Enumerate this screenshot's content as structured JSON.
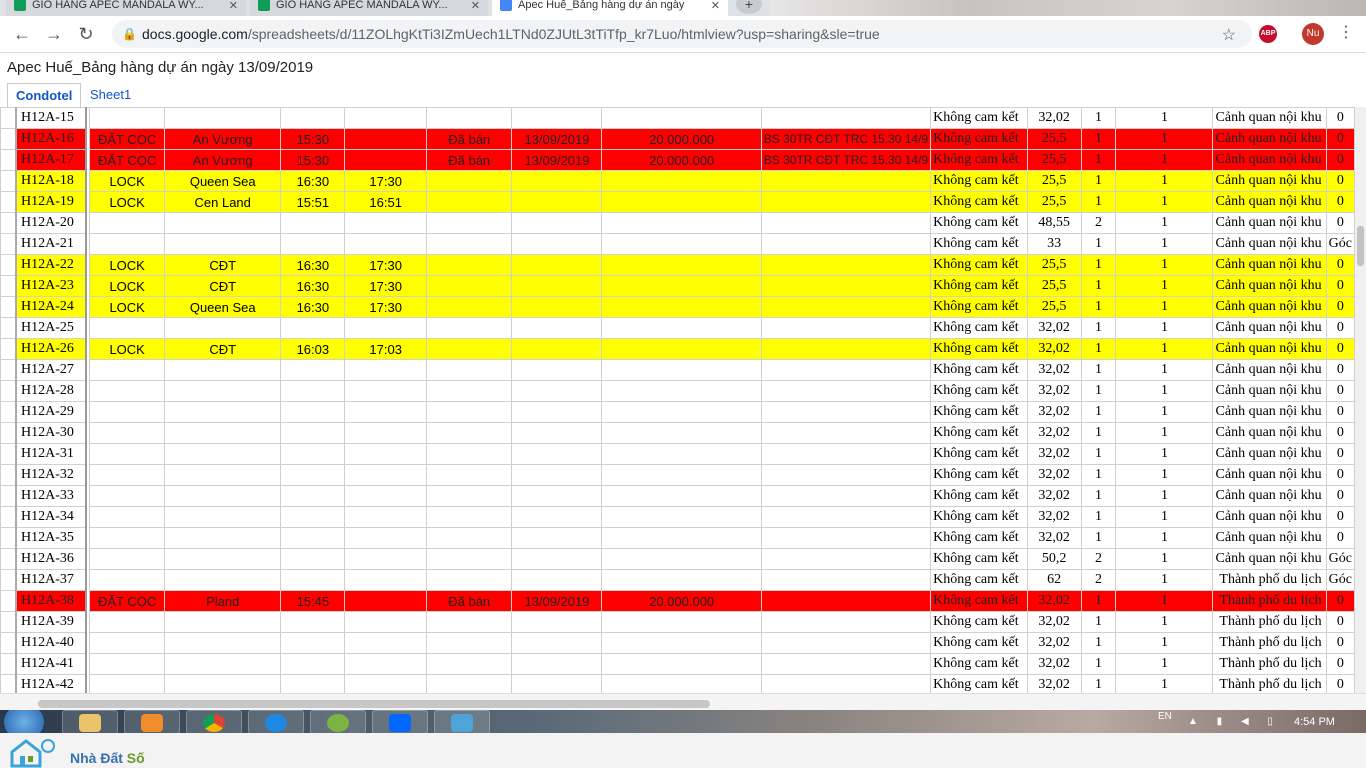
{
  "tabs": [
    {
      "title": "GIO HANG APEC MANDALA WY...",
      "icon_color": "#0f9d58"
    },
    {
      "title": "GIO HANG APEC MANDALA WY...",
      "icon_color": "#0f9d58"
    },
    {
      "title": "Apec Huế_Bảng hàng dự án ngày",
      "icon_color": "#4285f4"
    }
  ],
  "browser": {
    "url_host": "docs.google.com",
    "url_path": "/spreadsheets/d/11ZOLhgKtTi3IZmUech1LTNd0ZJUtL3tTiTfp_kr7Luo/htmlview?usp=sharing&sle=true",
    "abp_label": "ABP",
    "avatar_label": "Nu"
  },
  "doc": {
    "title": "Apec Huế_Bảng hàng dự án ngày 13/09/2019",
    "sheet_tabs": [
      "Condotel",
      "Sheet1"
    ],
    "active_sheet": "Condotel"
  },
  "colors": {
    "red": "#ff0000",
    "yellow": "#ffff00"
  },
  "rows": [
    {
      "rn": "",
      "code": "H12A-15",
      "status": "",
      "agent": "",
      "t1": "",
      "t2": "",
      "sold": "",
      "date": "",
      "deposit": "",
      "note": "",
      "commit": "Không cam kết",
      "area": "32,02",
      "br": "1",
      "wc": "1",
      "view": "Cảnh quan nội khu",
      "extra": "0",
      "style": "none"
    },
    {
      "rn": "",
      "code": "H12A-16",
      "status": "ĐẶT CỌC",
      "agent": "An Vương",
      "t1": "15:30",
      "t2": "",
      "sold": "Đã bán",
      "date": "13/09/2019",
      "deposit": "20.000.000",
      "note": "BS 30TR CĐT TRC 15.30 14/9",
      "commit": "Không cam kết",
      "area": "25,5",
      "br": "1",
      "wc": "1",
      "view": "Cảnh quan nội khu",
      "extra": "0",
      "style": "red"
    },
    {
      "rn": "",
      "code": "H12A-17",
      "status": "ĐẶT CỌC",
      "agent": "An Vương",
      "t1": "15:30",
      "t2": "",
      "sold": "Đã bán",
      "date": "13/09/2019",
      "deposit": "20.000.000",
      "note": "BS 30TR CĐT TRC 15.30 14/9",
      "commit": "Không cam kết",
      "area": "25,5",
      "br": "1",
      "wc": "1",
      "view": "Cảnh quan nội khu",
      "extra": "0",
      "style": "red"
    },
    {
      "rn": "",
      "code": "H12A-18",
      "status": "LOCK",
      "agent": "Queen Sea",
      "t1": "16:30",
      "t2": "17:30",
      "sold": "",
      "date": "",
      "deposit": "",
      "note": "",
      "commit": "Không cam kết",
      "area": "25,5",
      "br": "1",
      "wc": "1",
      "view": "Cảnh quan nội khu",
      "extra": "0",
      "style": "yellow"
    },
    {
      "rn": "",
      "code": "H12A-19",
      "status": "LOCK",
      "agent": "Cen Land",
      "t1": "15:51",
      "t2": "16:51",
      "sold": "",
      "date": "",
      "deposit": "",
      "note": "",
      "commit": "Không cam kết",
      "area": "25,5",
      "br": "1",
      "wc": "1",
      "view": "Cảnh quan nội khu",
      "extra": "0",
      "style": "yellow"
    },
    {
      "rn": "",
      "code": "H12A-20",
      "status": "",
      "agent": "",
      "t1": "",
      "t2": "",
      "sold": "",
      "date": "",
      "deposit": "",
      "note": "",
      "commit": "Không cam kết",
      "area": "48,55",
      "br": "2",
      "wc": "1",
      "view": "Cảnh quan nội khu",
      "extra": "0",
      "style": "none"
    },
    {
      "rn": "",
      "code": "H12A-21",
      "status": "",
      "agent": "",
      "t1": "",
      "t2": "",
      "sold": "",
      "date": "",
      "deposit": "",
      "note": "",
      "commit": "Không cam kết",
      "area": "33",
      "br": "1",
      "wc": "1",
      "view": "Cảnh quan nội khu",
      "extra": "Góc",
      "style": "none"
    },
    {
      "rn": "",
      "code": "H12A-22",
      "status": "LOCK",
      "agent": "CĐT",
      "t1": "16:30",
      "t2": "17:30",
      "sold": "",
      "date": "",
      "deposit": "",
      "note": "",
      "commit": "Không cam kết",
      "area": "25,5",
      "br": "1",
      "wc": "1",
      "view": "Cảnh quan nội khu",
      "extra": "0",
      "style": "yellow"
    },
    {
      "rn": "",
      "code": "H12A-23",
      "status": "LOCK",
      "agent": "CĐT",
      "t1": "16:30",
      "t2": "17:30",
      "sold": "",
      "date": "",
      "deposit": "",
      "note": "",
      "commit": "Không cam kết",
      "area": "25,5",
      "br": "1",
      "wc": "1",
      "view": "Cảnh quan nội khu",
      "extra": "0",
      "style": "yellow"
    },
    {
      "rn": "",
      "code": "H12A-24",
      "status": "LOCK",
      "agent": "Queen Sea",
      "t1": "16:30",
      "t2": "17:30",
      "sold": "",
      "date": "",
      "deposit": "",
      "note": "",
      "commit": "Không cam kết",
      "area": "25,5",
      "br": "1",
      "wc": "1",
      "view": "Cảnh quan nội khu",
      "extra": "0",
      "style": "yellow"
    },
    {
      "rn": "",
      "code": "H12A-25",
      "status": "",
      "agent": "",
      "t1": "",
      "t2": "",
      "sold": "",
      "date": "",
      "deposit": "",
      "note": "",
      "commit": "Không cam kết",
      "area": "32,02",
      "br": "1",
      "wc": "1",
      "view": "Cảnh quan nội khu",
      "extra": "0",
      "style": "none"
    },
    {
      "rn": "",
      "code": "H12A-26",
      "status": "LOCK",
      "agent": "CĐT",
      "t1": "16:03",
      "t2": "17:03",
      "sold": "",
      "date": "",
      "deposit": "",
      "note": "",
      "commit": "Không cam kết",
      "area": "32,02",
      "br": "1",
      "wc": "1",
      "view": "Cảnh quan nội khu",
      "extra": "0",
      "style": "yellow"
    },
    {
      "rn": "",
      "code": "H12A-27",
      "status": "",
      "agent": "",
      "t1": "",
      "t2": "",
      "sold": "",
      "date": "",
      "deposit": "",
      "note": "",
      "commit": "Không cam kết",
      "area": "32,02",
      "br": "1",
      "wc": "1",
      "view": "Cảnh quan nội khu",
      "extra": "0",
      "style": "none"
    },
    {
      "rn": "",
      "code": "H12A-28",
      "status": "",
      "agent": "",
      "t1": "",
      "t2": "",
      "sold": "",
      "date": "",
      "deposit": "",
      "note": "",
      "commit": "Không cam kết",
      "area": "32,02",
      "br": "1",
      "wc": "1",
      "view": "Cảnh quan nội khu",
      "extra": "0",
      "style": "none"
    },
    {
      "rn": "",
      "code": "H12A-29",
      "status": "",
      "agent": "",
      "t1": "",
      "t2": "",
      "sold": "",
      "date": "",
      "deposit": "",
      "note": "",
      "commit": "Không cam kết",
      "area": "32,02",
      "br": "1",
      "wc": "1",
      "view": "Cảnh quan nội khu",
      "extra": "0",
      "style": "none"
    },
    {
      "rn": "",
      "code": "H12A-30",
      "status": "",
      "agent": "",
      "t1": "",
      "t2": "",
      "sold": "",
      "date": "",
      "deposit": "",
      "note": "",
      "commit": "Không cam kết",
      "area": "32,02",
      "br": "1",
      "wc": "1",
      "view": "Cảnh quan nội khu",
      "extra": "0",
      "style": "none"
    },
    {
      "rn": "",
      "code": "H12A-31",
      "status": "",
      "agent": "",
      "t1": "",
      "t2": "",
      "sold": "",
      "date": "",
      "deposit": "",
      "note": "",
      "commit": "Không cam kết",
      "area": "32,02",
      "br": "1",
      "wc": "1",
      "view": "Cảnh quan nội khu",
      "extra": "0",
      "style": "none"
    },
    {
      "rn": "",
      "code": "H12A-32",
      "status": "",
      "agent": "",
      "t1": "",
      "t2": "",
      "sold": "",
      "date": "",
      "deposit": "",
      "note": "",
      "commit": "Không cam kết",
      "area": "32,02",
      "br": "1",
      "wc": "1",
      "view": "Cảnh quan nội khu",
      "extra": "0",
      "style": "none"
    },
    {
      "rn": "",
      "code": "H12A-33",
      "status": "",
      "agent": "",
      "t1": "",
      "t2": "",
      "sold": "",
      "date": "",
      "deposit": "",
      "note": "",
      "commit": "Không cam kết",
      "area": "32,02",
      "br": "1",
      "wc": "1",
      "view": "Cảnh quan nội khu",
      "extra": "0",
      "style": "none"
    },
    {
      "rn": "",
      "code": "H12A-34",
      "status": "",
      "agent": "",
      "t1": "",
      "t2": "",
      "sold": "",
      "date": "",
      "deposit": "",
      "note": "",
      "commit": "Không cam kết",
      "area": "32,02",
      "br": "1",
      "wc": "1",
      "view": "Cảnh quan nội khu",
      "extra": "0",
      "style": "none"
    },
    {
      "rn": "",
      "code": "H12A-35",
      "status": "",
      "agent": "",
      "t1": "",
      "t2": "",
      "sold": "",
      "date": "",
      "deposit": "",
      "note": "",
      "commit": "Không cam kết",
      "area": "32,02",
      "br": "1",
      "wc": "1",
      "view": "Cảnh quan nội khu",
      "extra": "0",
      "style": "none"
    },
    {
      "rn": "",
      "code": "H12A-36",
      "status": "",
      "agent": "",
      "t1": "",
      "t2": "",
      "sold": "",
      "date": "",
      "deposit": "",
      "note": "",
      "commit": "Không cam kết",
      "area": "50,2",
      "br": "2",
      "wc": "1",
      "view": "Cảnh quan nội khu",
      "extra": "Góc",
      "style": "none"
    },
    {
      "rn": "",
      "code": "H12A-37",
      "status": "",
      "agent": "",
      "t1": "",
      "t2": "",
      "sold": "",
      "date": "",
      "deposit": "",
      "note": "",
      "commit": "Không cam kết",
      "area": "62",
      "br": "2",
      "wc": "1",
      "view": "Thành phố du lịch",
      "extra": "Góc",
      "style": "none"
    },
    {
      "rn": "",
      "code": "H12A-38",
      "status": "ĐẶT CỌC",
      "agent": "Pland",
      "t1": "15:45",
      "t2": "",
      "sold": "Đã bán",
      "date": "13/09/2019",
      "deposit": "20.000.000",
      "note": "",
      "commit": "Không cam kết",
      "area": "32,02",
      "br": "1",
      "wc": "1",
      "view": "Thành phố du lịch",
      "extra": "0",
      "style": "red"
    },
    {
      "rn": "",
      "code": "H12A-39",
      "status": "",
      "agent": "",
      "t1": "",
      "t2": "",
      "sold": "",
      "date": "",
      "deposit": "",
      "note": "",
      "commit": "Không cam kết",
      "area": "32,02",
      "br": "1",
      "wc": "1",
      "view": "Thành phố du lịch",
      "extra": "0",
      "style": "none"
    },
    {
      "rn": "",
      "code": "H12A-40",
      "status": "",
      "agent": "",
      "t1": "",
      "t2": "",
      "sold": "",
      "date": "",
      "deposit": "",
      "note": "",
      "commit": "Không cam kết",
      "area": "32,02",
      "br": "1",
      "wc": "1",
      "view": "Thành phố du lịch",
      "extra": "0",
      "style": "none"
    },
    {
      "rn": "",
      "code": "H12A-41",
      "status": "",
      "agent": "",
      "t1": "",
      "t2": "",
      "sold": "",
      "date": "",
      "deposit": "",
      "note": "",
      "commit": "Không cam kết",
      "area": "32,02",
      "br": "1",
      "wc": "1",
      "view": "Thành phố du lịch",
      "extra": "0",
      "style": "none"
    },
    {
      "rn": "",
      "code": "H12A-42",
      "status": "",
      "agent": "",
      "t1": "",
      "t2": "",
      "sold": "",
      "date": "",
      "deposit": "",
      "note": "",
      "commit": "Không cam kết",
      "area": "32,02",
      "br": "1",
      "wc": "1",
      "view": "Thành phố du lịch",
      "extra": "0",
      "style": "none"
    }
  ],
  "taskbar": {
    "lang": "EN",
    "clock": "4:54 PM",
    "apps": [
      "start-icon",
      "folder-icon",
      "media-player-icon",
      "chrome-icon",
      "ie-icon",
      "coccoc-icon",
      "zalo-icon",
      "photo-viewer-icon"
    ]
  },
  "watermark": {
    "brand_a": "Nhà Đất ",
    "brand_b": "Số"
  }
}
